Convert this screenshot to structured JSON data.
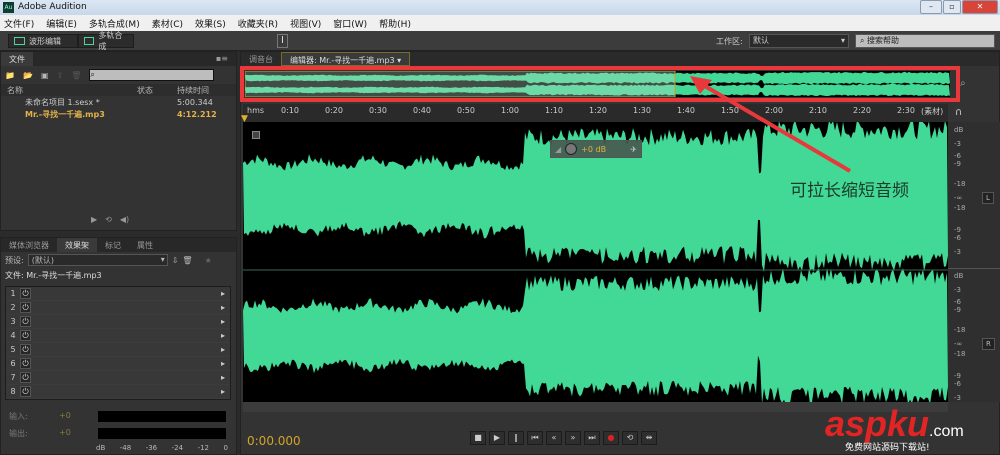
{
  "app": {
    "title": "Adobe Audition",
    "logo": "Au"
  },
  "menu": [
    "文件(F)",
    "编辑(E)",
    "多轨合成(M)",
    "素材(C)",
    "效果(S)",
    "收藏夹(R)",
    "视图(V)",
    "窗口(W)",
    "帮助(H)"
  ],
  "toolbar": {
    "waveform_edit": "波形编辑",
    "multitrack": "多轨合成",
    "workspace_label": "工作区:",
    "workspace_value": "默认",
    "search_placeholder": "搜索帮助"
  },
  "files_panel": {
    "tab": "文件",
    "columns": [
      "名称",
      "状态",
      "持续时间"
    ],
    "rows": [
      {
        "name": "未命名项目 1.sesx *",
        "duration": "5:00.344"
      },
      {
        "name": "Mr.-寻找一千遍.mp3",
        "duration": "4:12.212"
      }
    ]
  },
  "effects_panel": {
    "tabs": [
      "媒体浏览器",
      "效果架",
      "标记",
      "属性"
    ],
    "preset_label": "预设:",
    "preset_value": "(默认)",
    "file_label": "文件: Mr.-寻找一千遍.mp3",
    "slots": [
      "1",
      "2",
      "3",
      "4",
      "5",
      "6",
      "7",
      "8"
    ],
    "input_label": "输入:",
    "output_label": "输出:",
    "input_value": "+0",
    "output_value": "+0",
    "meter_ticks": [
      "dB",
      "-48",
      "-36",
      "-24",
      "-12",
      "0"
    ]
  },
  "editor": {
    "tabs": [
      "调音台",
      "编辑器: Mr.-寻找一千遍.mp3"
    ],
    "ruler": [
      "hms",
      "0:10",
      "0:20",
      "0:30",
      "0:40",
      "0:50",
      "1:00",
      "1:10",
      "1:20",
      "1:30",
      "1:40",
      "1:50",
      "2:00",
      "2:10",
      "2:20",
      "2:30",
      "(素材)"
    ],
    "db_scale": [
      "dB",
      "-3",
      "-6",
      "-9",
      "-18",
      "-∞",
      "-18",
      "-9",
      "-6",
      "-3"
    ],
    "channels": [
      "L",
      "R"
    ],
    "hud_gain": "+0 dB",
    "annotation": "可拉长缩短音频",
    "time": "0:00.000",
    "overview_view_fraction": 0.61
  },
  "watermark": {
    "brand": "aspku.com",
    "sub": "免费网站源码下载站!"
  },
  "colors": {
    "wave": "#42d896",
    "highlight": "#e8383b",
    "time": "#d4a32a"
  }
}
